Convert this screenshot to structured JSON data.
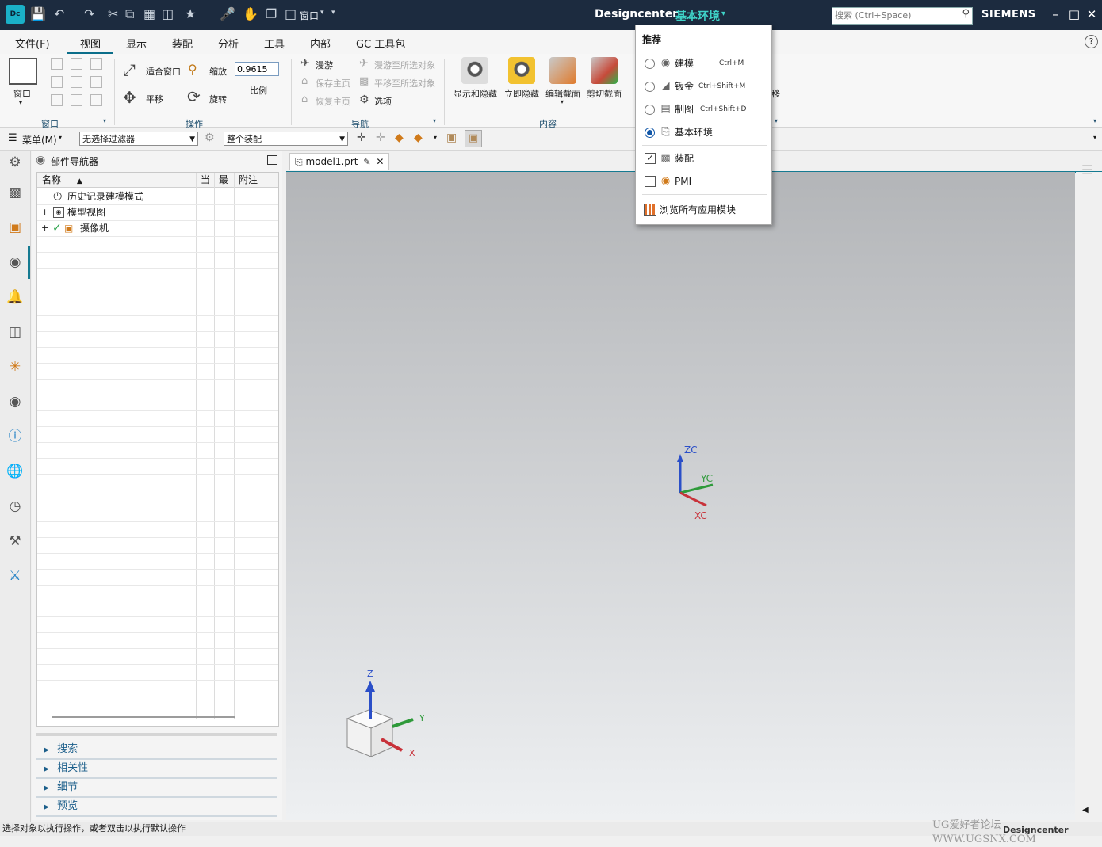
{
  "titlebar": {
    "logo": "Dc",
    "app_name": "Designcenter",
    "environment": "基本环境",
    "window_menu_label": "窗口",
    "search_placeholder": "搜索 (Ctrl+Space)",
    "brand": "SIEMENS",
    "icons": [
      "save-icon",
      "undo-icon",
      "redo-icon",
      "cut-icon",
      "copy-icon",
      "paste-icon",
      "duplicate-icon",
      "star-icon",
      "microphone-icon",
      "touch-mode-icon",
      "window-icon",
      "layout-icon",
      "search-icon",
      "minimize-icon",
      "maximize-icon",
      "close-icon"
    ]
  },
  "tabs": [
    "文件(F)",
    "视图",
    "显示",
    "装配",
    "分析",
    "工具",
    "内部",
    "GC 工具包"
  ],
  "active_tab": "视图",
  "ribbon": {
    "window": {
      "button": "窗口",
      "group": "窗口"
    },
    "operations": {
      "fit": "适合窗口",
      "zoom": "缩放",
      "scale_value": "0.9615",
      "scale_label": "比例",
      "pan": "平移",
      "rotate": "旋转",
      "group": "操作"
    },
    "navigation": {
      "fly": "漫游",
      "save_home": "保存主页",
      "restore_home": "恢复主页",
      "fly_to_selected": "漫游至所选对象",
      "pan_to_selected": "平移至所选对象",
      "options": "选项",
      "group": "导航"
    },
    "content": {
      "show_hide": "显示和隐藏",
      "immediate_hide": "立即隐藏",
      "edit_section": "编辑截面",
      "clip_section": "剪切截面",
      "truncated": "移",
      "group": "内容"
    }
  },
  "filterbar": {
    "menu": "菜单(M)",
    "selection_filter": "无选择过滤器",
    "scope": "整个装配"
  },
  "navigator": {
    "title": "部件导航器",
    "columns": [
      "名称",
      "当",
      "最",
      "附注"
    ],
    "rows": [
      {
        "label": "历史记录建模模式"
      },
      {
        "label": "模型视图"
      },
      {
        "label": "摄像机"
      }
    ],
    "panels": [
      "搜索",
      "相关性",
      "细节",
      "预览"
    ]
  },
  "document_tab": "model1.prt",
  "viewport": {
    "wcs": {
      "z": "ZC",
      "y": "YC",
      "x": "XC"
    },
    "triad": {
      "z": "Z",
      "y": "Y",
      "x": "X"
    }
  },
  "statusbar": {
    "message": "选择对象以执行操作，或者双击以执行默认操作",
    "watermark": "UG爱好者论坛 WWW.UGSNX.COM",
    "right_label": "Designcenter"
  },
  "app_menu": {
    "header": "推荐",
    "items": [
      {
        "label": "建模",
        "shortcut": "Ctrl+M",
        "selected": false
      },
      {
        "label": "钣金",
        "shortcut": "Ctrl+Shift+M",
        "selected": false
      },
      {
        "label": "制图",
        "shortcut": "Ctrl+Shift+D",
        "selected": false
      },
      {
        "label": "基本环境",
        "shortcut": "",
        "selected": true
      }
    ],
    "toggles": [
      {
        "label": "装配",
        "checked": true
      },
      {
        "label": "PMI",
        "checked": false
      }
    ],
    "browse_all": "浏览所有应用模块"
  },
  "colors": {
    "titlebar": "#1c2b3f",
    "accent": "#0b6e8a",
    "environment_text": "#3fd3c8",
    "wcs_z": "#2b4fc8",
    "wcs_y": "#2e9a3a",
    "wcs_x": "#c8323a"
  }
}
